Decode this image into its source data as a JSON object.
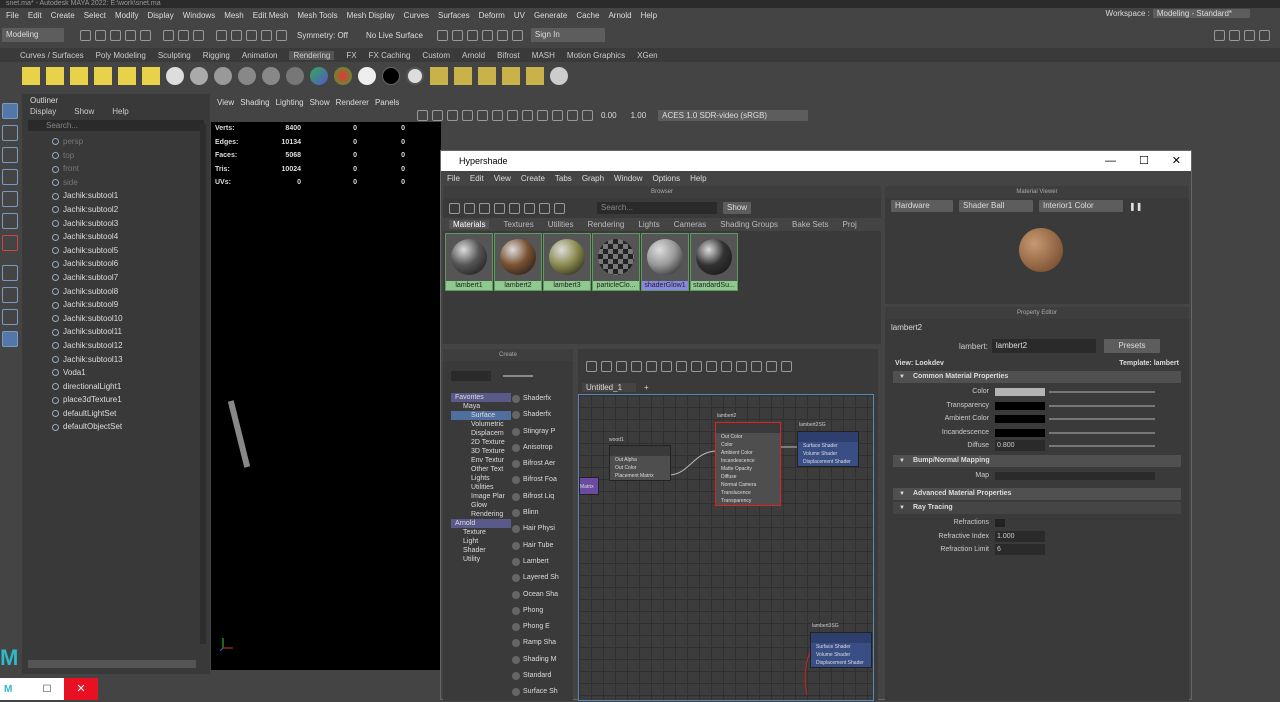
{
  "window_title": "snet.ma* - Autodesk MAYA 2022: E:\\work\\snet.ma",
  "menus": [
    "File",
    "Edit",
    "Create",
    "Select",
    "Modify",
    "Display",
    "Windows",
    "Mesh",
    "Edit Mesh",
    "Mesh Tools",
    "Mesh Display",
    "Curves",
    "Surfaces",
    "Deform",
    "UV",
    "Generate",
    "Cache",
    "Arnold",
    "Help"
  ],
  "workspace": {
    "label": "Workspace :",
    "value": "Modeling - Standard*"
  },
  "status": {
    "mode": "Modeling",
    "symmetry": "Symmetry: Off",
    "live": "No Live Surface",
    "sign_in": "Sign In"
  },
  "shelf_tabs": [
    "Curves / Surfaces",
    "Poly Modeling",
    "Sculpting",
    "Rigging",
    "Animation",
    "Rendering",
    "FX",
    "FX Caching",
    "Custom",
    "Arnold",
    "Bifrost",
    "MASH",
    "Motion Graphics",
    "XGen"
  ],
  "shelf_active": "Rendering",
  "outliner": {
    "title": "Outliner",
    "menus": [
      "Display",
      "Show",
      "Help"
    ],
    "search_placeholder": "Search...",
    "items": [
      {
        "label": "persp",
        "dim": true
      },
      {
        "label": "top",
        "dim": true
      },
      {
        "label": "front",
        "dim": true
      },
      {
        "label": "side",
        "dim": true
      },
      {
        "label": "Jachik:subtool1"
      },
      {
        "label": "Jachik:subtool2"
      },
      {
        "label": "Jachik:subtool3"
      },
      {
        "label": "Jachik:subtool4"
      },
      {
        "label": "Jachik:subtool5"
      },
      {
        "label": "Jachik:subtool6"
      },
      {
        "label": "Jachik:subtool7"
      },
      {
        "label": "Jachik:subtool8"
      },
      {
        "label": "Jachik:subtool9"
      },
      {
        "label": "Jachik:subtool10"
      },
      {
        "label": "Jachik:subtool11"
      },
      {
        "label": "Jachik:subtool12"
      },
      {
        "label": "Jachik:subtool13"
      },
      {
        "label": "Voda1"
      },
      {
        "label": "directionalLight1"
      },
      {
        "label": "place3dTexture1"
      },
      {
        "label": "defaultLightSet"
      },
      {
        "label": "defaultObjectSet"
      }
    ]
  },
  "viewport": {
    "menus": [
      "View",
      "Shading",
      "Lighting",
      "Show",
      "Renderer",
      "Panels"
    ],
    "val1": "0.00",
    "val2": "1.00",
    "colorspace": "ACES 1.0 SDR-video (sRGB)",
    "stats": [
      {
        "k": "Verts:",
        "a": "8400",
        "b": "0",
        "c": "0"
      },
      {
        "k": "Edges:",
        "a": "10134",
        "b": "0",
        "c": "0"
      },
      {
        "k": "Faces:",
        "a": "5068",
        "b": "0",
        "c": "0"
      },
      {
        "k": "Tris:",
        "a": "10024",
        "b": "0",
        "c": "0"
      },
      {
        "k": "UVs:",
        "a": "0",
        "b": "0",
        "c": "0"
      }
    ]
  },
  "hypershade": {
    "title": "Hypershade",
    "menus": [
      "File",
      "Edit",
      "View",
      "Create",
      "Tabs",
      "Graph",
      "Window",
      "Options",
      "Help"
    ],
    "browser": {
      "title": "Browser",
      "search_placeholder": "Search...",
      "show": "Show",
      "tabs": [
        "Materials",
        "Textures",
        "Utilities",
        "Rendering",
        "Lights",
        "Cameras",
        "Shading Groups",
        "Bake Sets",
        "Proj"
      ],
      "materials": [
        {
          "name": "lambert1",
          "color": "#555"
        },
        {
          "name": "lambert2",
          "color": "#7a5232"
        },
        {
          "name": "lambert3",
          "color": "#8c8c50"
        },
        {
          "name": "particleClo...",
          "color": "checker"
        },
        {
          "name": "shaderGlow1",
          "color": "#999"
        },
        {
          "name": "standardSu...",
          "color": "#333"
        }
      ]
    },
    "create": {
      "title": "Create",
      "tree": [
        "Favorites",
        "Maya",
        "Surface",
        "Volumetric",
        "Displacem",
        "2D Texture",
        "3D Texture",
        "Env Textur",
        "Other Text",
        "Lights",
        "Utilities",
        "Image Plar",
        "Glow",
        "Rendering",
        "Arnold",
        "Texture",
        "Light",
        "Shader",
        "Utility"
      ],
      "items": [
        "Shaderfx",
        "Shaderfx",
        "Stingray P",
        "Anisotrop",
        "Bifrost Aer",
        "Bifrost Foa",
        "Bifrost Liq",
        "Blinn",
        "Hair Physi",
        "Hair Tube",
        "Lambert",
        "Layered Sh",
        "Ocean Sha",
        "Phong",
        "Phong E",
        "Ramp Sha",
        "Shading M",
        "Standard",
        "Surface Sh"
      ]
    },
    "graph": {
      "tab": "Untitled_1",
      "tab_add": "+",
      "nodes": {
        "wood": {
          "name": "wood1",
          "ports": [
            "Out Alpha",
            "Out Color",
            "Placement Matrix"
          ]
        },
        "lambert2": {
          "name": "lambert2",
          "ports": [
            "Out Color",
            "Color",
            "Ambient Color",
            "Incandescence",
            "Matte Opacity",
            "Diffuse",
            "Normal Camera",
            "Translucence",
            "Transparency"
          ]
        },
        "sg2": {
          "name": "lambert2SG",
          "ports": [
            "Surface Shader",
            "Volume Shader",
            "Displacement Shader"
          ]
        },
        "sg3": {
          "name": "lambert3SG",
          "ports": [
            "Surface Shader",
            "Volume Shader",
            "Displacement Shader"
          ]
        },
        "matrix": "Matrix"
      }
    },
    "viewer": {
      "title": "Material Viewer",
      "renderer": "Hardware",
      "shape": "Shader Ball",
      "env": "Interior1 Color"
    },
    "property": {
      "title": "Property Editor",
      "tab": "lambert2",
      "label": "lambert:",
      "name": "lambert2",
      "presets": "Presets",
      "view": "View: Lookdev",
      "template": "Template: lambert",
      "common": "Common Material Properties",
      "props": [
        {
          "label": "Color",
          "color": "#b4b4b4",
          "v": ""
        },
        {
          "label": "Transparency",
          "color": "#000",
          "v": ""
        },
        {
          "label": "Ambient Color",
          "color": "#000",
          "v": ""
        },
        {
          "label": "Incandescence",
          "color": "#000",
          "v": ""
        },
        {
          "label": "Diffuse",
          "color": "",
          "v": "0.800"
        }
      ],
      "bump": "Bump/Normal Mapping",
      "map": "Map",
      "advanced": "Advanced Material Properties",
      "raytracing": "Ray Tracing",
      "rt": [
        {
          "label": "Refractions",
          "v": ""
        },
        {
          "label": "Refractive Index",
          "v": "1.000"
        },
        {
          "label": "Refraction Limit",
          "v": "6"
        }
      ]
    }
  }
}
